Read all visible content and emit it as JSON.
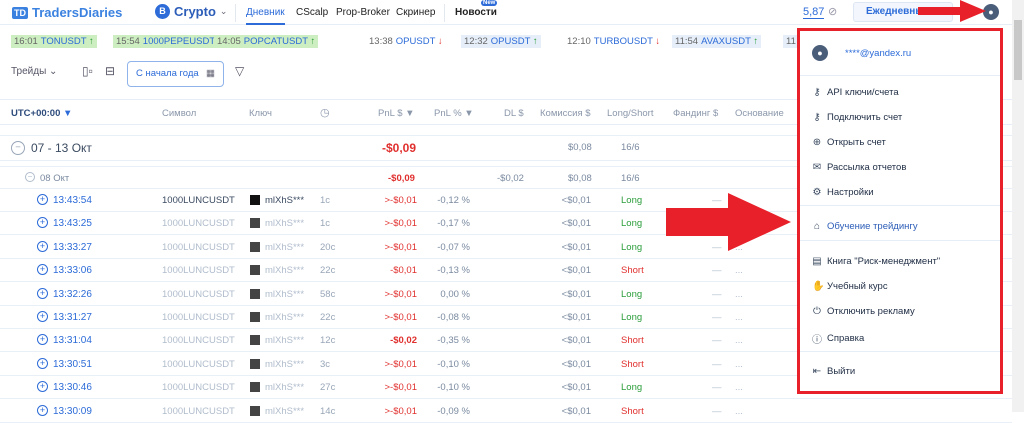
{
  "header": {
    "logo": "TradersDiaries",
    "logo_mark": "TD",
    "market": "Crypto",
    "nav": [
      "Дневник",
      "CScalp",
      "Prop-Broker",
      "Скринер",
      "Новости"
    ],
    "new_badge": "New",
    "balance": "5,87",
    "daily_button": "Ежедневные о"
  },
  "ticker": [
    {
      "time": "16:01",
      "symbol": "TONUSDT",
      "dir": "up",
      "bg": "#cdeec0"
    },
    {
      "time": "15:54",
      "symbol": "1000PEPEUSDT",
      "dir": "up",
      "bg": "#cdeec0"
    },
    {
      "time": "14:05",
      "symbol": "POPCATUSDT",
      "dir": "up",
      "bg": "#cdeec0"
    },
    {
      "time": "13:38",
      "symbol": "OPUSDT",
      "dir": "down",
      "bg": "#ffffff"
    },
    {
      "time": "12:32",
      "symbol": "OPUSDT",
      "dir": "up",
      "bg": "#e6eef9"
    },
    {
      "time": "12:10",
      "symbol": "TURBOUSDT",
      "dir": "down",
      "bg": "#ffffff"
    },
    {
      "time": "11:54",
      "symbol": "AVAXUSDT",
      "dir": "up",
      "bg": "#e6eef9"
    },
    {
      "time": "11",
      "symbol": "",
      "dir": "",
      "bg": "#e6eef9"
    }
  ],
  "toolbar": {
    "view": "Трейды",
    "date_range": "С начала года"
  },
  "table": {
    "headers": {
      "time": "UTC+00:00",
      "symbol": "Символ",
      "key": "Ключ",
      "pnl": "PnL $",
      "pnl_pct": "PnL %",
      "dl": "DL $",
      "commission": "Комиссия $",
      "side": "Long/Short",
      "funding": "Фандинг $",
      "basis": "Основание"
    },
    "week": {
      "label": "07 - 13 Окт",
      "pnl": "-$0,09",
      "commission": "$0,08",
      "ratio": "16/6"
    },
    "day": {
      "label": "08 Окт",
      "pnl": "-$0,09",
      "dl": "-$0,02",
      "commission": "$0,08",
      "ratio": "16/6"
    },
    "rows": [
      {
        "time": "13:43:54",
        "symbol": "1000LUNCUSDT",
        "key": "mlXhS***",
        "dur": "1с",
        "pnl": ">-$0,01",
        "pct": "-0,12 %",
        "comm": "<$0,01",
        "side": "Long"
      },
      {
        "time": "13:43:25",
        "symbol": "1000LUNCUSDT",
        "key": "mlXhS***",
        "dur": "1с",
        "pnl": ">-$0,01",
        "pct": "-0,17 %",
        "comm": "<$0,01",
        "side": "Long"
      },
      {
        "time": "13:33:27",
        "symbol": "1000LUNCUSDT",
        "key": "mlXhS***",
        "dur": "20с",
        "pnl": ">-$0,01",
        "pct": "-0,07 %",
        "comm": "<$0,01",
        "side": "Long"
      },
      {
        "time": "13:33:06",
        "symbol": "1000LUNCUSDT",
        "key": "mlXhS***",
        "dur": "22с",
        "pnl": "-$0,01",
        "pct": "-0,13 %",
        "comm": "<$0,01",
        "side": "Short"
      },
      {
        "time": "13:32:26",
        "symbol": "1000LUNCUSDT",
        "key": "mlXhS***",
        "dur": "58с",
        "pnl": ">-$0,01",
        "pct": "0,00 %",
        "comm": "<$0,01",
        "side": "Long"
      },
      {
        "time": "13:31:27",
        "symbol": "1000LUNCUSDT",
        "key": "mlXhS***",
        "dur": "22с",
        "pnl": ">-$0,01",
        "pct": "-0,08 %",
        "comm": "<$0,01",
        "side": "Long"
      },
      {
        "time": "13:31:04",
        "symbol": "1000LUNCUSDT",
        "key": "mlXhS***",
        "dur": "12с",
        "pnl": "-$0,02",
        "pct": "-0,35 %",
        "comm": "<$0,01",
        "side": "Short"
      },
      {
        "time": "13:30:51",
        "symbol": "1000LUNCUSDT",
        "key": "mlXhS***",
        "dur": "3с",
        "pnl": ">-$0,01",
        "pct": "-0,10 %",
        "comm": "<$0,01",
        "side": "Short"
      },
      {
        "time": "13:30:46",
        "symbol": "1000LUNCUSDT",
        "key": "mlXhS***",
        "dur": "27с",
        "pnl": ">-$0,01",
        "pct": "-0,10 %",
        "comm": "<$0,01",
        "side": "Long"
      },
      {
        "time": "13:30:09",
        "symbol": "1000LUNCUSDT",
        "key": "mlXhS***",
        "dur": "14с",
        "pnl": ">-$0,01",
        "pct": "-0,09 %",
        "comm": "<$0,01",
        "side": "Short"
      }
    ],
    "funding_empty": "—",
    "basis_empty": "..."
  },
  "menu": {
    "email": "****@yandex.ru",
    "items": [
      {
        "label": "API ключи/счета",
        "icon": "key-icon"
      },
      {
        "label": "Подключить счет",
        "icon": "key-plus-icon"
      },
      {
        "label": "Открыть счет",
        "icon": "plus-circle-icon"
      },
      {
        "label": "Рассылка отчетов",
        "icon": "mail-icon"
      },
      {
        "label": "Настройки",
        "icon": "gear-icon"
      },
      {
        "label": "Обучение трейдингу",
        "icon": "graduation-cap-icon"
      },
      {
        "label": "Книга \"Риск-менеджмент\"",
        "icon": "book-icon"
      },
      {
        "label": "Учебный курс",
        "icon": "hand-icon"
      },
      {
        "label": "Отключить рекламу",
        "icon": "power-icon"
      },
      {
        "label": "Справка",
        "icon": "info-icon"
      },
      {
        "label": "Выйти",
        "icon": "logout-icon"
      }
    ]
  }
}
